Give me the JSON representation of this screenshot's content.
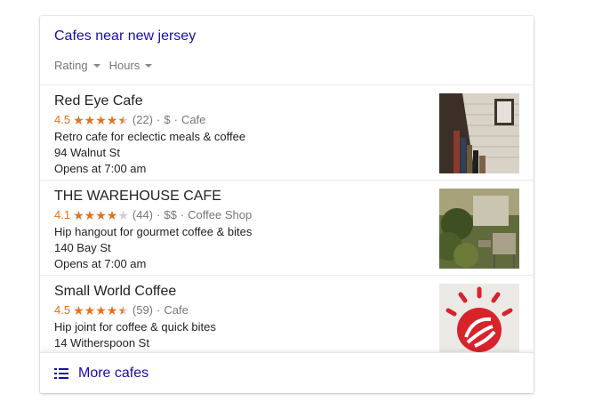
{
  "header": {
    "title": "Cafes near new jersey"
  },
  "filters": [
    {
      "label": "Rating"
    },
    {
      "label": "Hours"
    }
  ],
  "results": [
    {
      "name": "Red Eye Cafe",
      "rating": "4.5",
      "stars_value": 4.5,
      "reviews": "(22)",
      "price": "$",
      "category": "Cafe",
      "description": "Retro cafe for eclectic meals & coffee",
      "address": "94 Walnut St",
      "hours": "Opens at 7:00 am"
    },
    {
      "name": "THE WAREHOUSE CAFE",
      "rating": "4.1",
      "stars_value": 4.1,
      "reviews": "(44)",
      "price": "$$",
      "category": "Coffee Shop",
      "description": "Hip hangout for gourmet coffee & bites",
      "address": "140 Bay St",
      "hours": "Opens at 7:00 am"
    },
    {
      "name": "Small World Coffee",
      "rating": "4.5",
      "stars_value": 4.5,
      "reviews": "(59)",
      "category": "Cafe",
      "description": "Hip joint for coffee & quick bites",
      "address": "14 Witherspoon St"
    }
  ],
  "separator": "·",
  "footer": {
    "more_label": "More cafes"
  },
  "colors": {
    "link": "#1a0dab",
    "star": "#e7711b",
    "meta": "#777777"
  }
}
